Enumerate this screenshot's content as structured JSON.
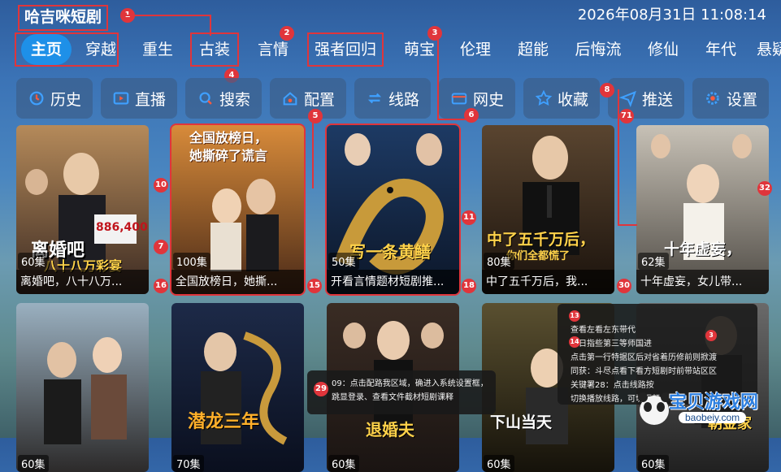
{
  "app": {
    "title": "哈吉咪短剧",
    "clock": "2026年08月31日 11:08:14"
  },
  "nav": {
    "items": [
      {
        "label": "主页"
      },
      {
        "label": "穿越"
      },
      {
        "label": "重生"
      },
      {
        "label": "古装"
      },
      {
        "label": "言情"
      },
      {
        "label": "强者回归"
      },
      {
        "label": "萌宝"
      },
      {
        "label": "伦理"
      },
      {
        "label": "超能"
      },
      {
        "label": "后悔流"
      },
      {
        "label": "修仙"
      },
      {
        "label": "年代"
      },
      {
        "label": "悬疑"
      }
    ]
  },
  "toolbar": {
    "items": [
      {
        "label": "历史",
        "icon": "history-icon"
      },
      {
        "label": "直播",
        "icon": "tv-icon"
      },
      {
        "label": "搜索",
        "icon": "search-icon"
      },
      {
        "label": "配置",
        "icon": "home-gear-icon"
      },
      {
        "label": "线路",
        "icon": "route-icon"
      },
      {
        "label": "网史",
        "icon": "card-icon"
      },
      {
        "label": "收藏",
        "icon": "star-icon"
      },
      {
        "label": "推送",
        "icon": "send-icon"
      },
      {
        "label": "设置",
        "icon": "gear-icon"
      }
    ]
  },
  "posters_row1": [
    {
      "episodes": "60集",
      "title": "离婚吧，八十八万...",
      "art_text": "离婚吧",
      "art_sub": "八十八万彩宴",
      "art_num": "886,400"
    },
    {
      "episodes": "100集",
      "title": "全国放榜日，她撕...",
      "art_text": "全国放榜日，",
      "art_sub": "她撕碎了谎言"
    },
    {
      "episodes": "50集",
      "title": "开看言情题材短剧推...",
      "art_text": "写一条黄鳝"
    },
    {
      "episodes": "80集",
      "title": "中了五千万后，我...",
      "art_text": "中了五千万后，",
      "art_sub": "你们全都慌了"
    },
    {
      "episodes": "62集",
      "title": "十年虚妄，女儿带...",
      "art_text": "十年虚妄，"
    }
  ],
  "posters_row2": [
    {
      "episodes": "60集",
      "art_text": ""
    },
    {
      "episodes": "70集",
      "art_text": "潜龙三年"
    },
    {
      "episodes": "60集",
      "art_text": "退婚夫"
    },
    {
      "episodes": "60集",
      "art_text": "下山当天"
    },
    {
      "episodes": "60集",
      "art_text": "一朝金家"
    }
  ],
  "annotations": [
    "1",
    "2",
    "3",
    "4",
    "5",
    "6",
    "7",
    "8",
    "10",
    "11",
    "15",
    "16",
    "18",
    "30",
    "32",
    "71",
    "9"
  ],
  "tooltip_left": {
    "badge": "29",
    "lines": [
      "09：点击配路我区域，确进入系统设置框，",
      "跳显登录、查看文件截材短剧课释"
    ]
  },
  "tooltip_right": {
    "badges": [
      "13",
      "14",
      "3"
    ],
    "lines": [
      "查看左看左东带代",
      "备日指些第三等师国进",
      "点击第一行特据区后对省着历修前则掀渡",
      "同获：斗尽点看下看方短剧时前带站区区",
      "关键署28：点击线路按",
      "切换播放线路，可切面频"
    ]
  },
  "watermark": {
    "text": "宝贝游戏网",
    "url": "baobeiy.com"
  },
  "colors": {
    "accent": "#e0353b",
    "active_tab": "#1e90e8"
  }
}
